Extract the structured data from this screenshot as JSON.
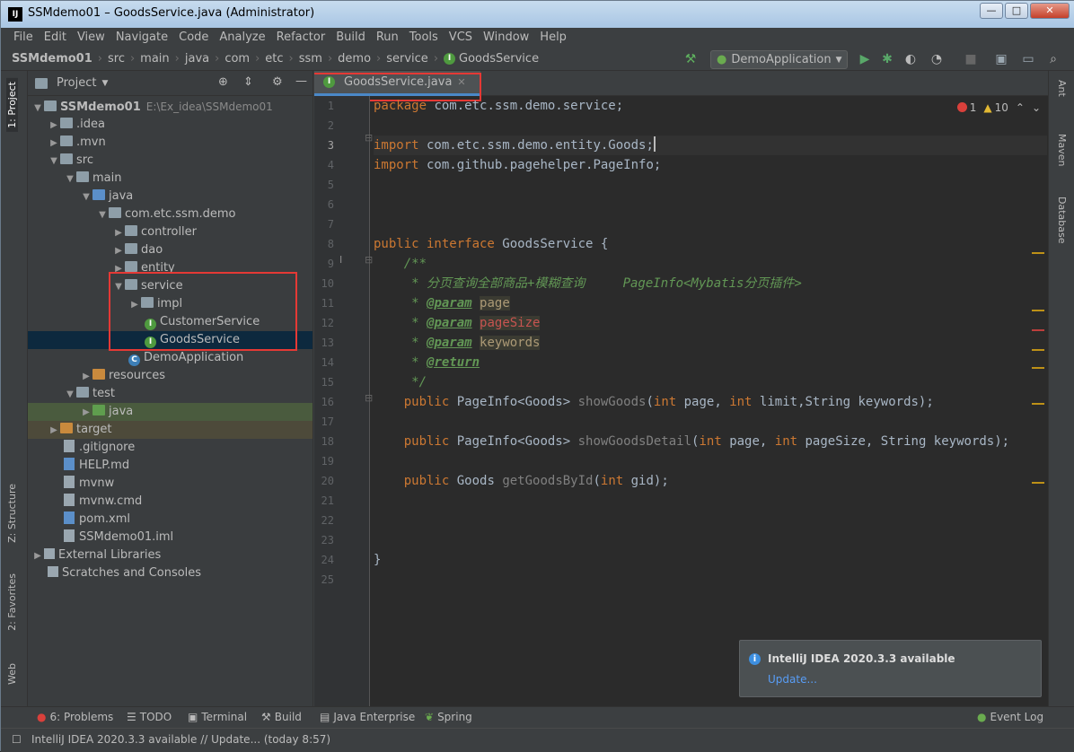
{
  "window": {
    "title": "SSMdemo01 – GoodsService.java (Administrator)",
    "icon": "IJ",
    "controls": {
      "minimize": "—",
      "maximize": "□",
      "close": "✕"
    }
  },
  "menu": [
    "File",
    "Edit",
    "View",
    "Navigate",
    "Code",
    "Analyze",
    "Refactor",
    "Build",
    "Run",
    "Tools",
    "VCS",
    "Window",
    "Help"
  ],
  "breadcrumb": [
    "SSMdemo01",
    "src",
    "main",
    "java",
    "com",
    "etc",
    "ssm",
    "demo",
    "service",
    "GoodsService"
  ],
  "run_config": {
    "label": "DemoApplication"
  },
  "left_tabs": {
    "project": "1: Project",
    "structure": "Z: Structure",
    "favorites": "2: Favorites",
    "web": "Web"
  },
  "right_tabs": {
    "ant": "Ant",
    "maven": "Maven",
    "database": "Database"
  },
  "project_panel": {
    "title": "Project",
    "tree": [
      {
        "label": "SSMdemo01",
        "extra": "E:\\Ex_idea\\SSMdemo01"
      },
      {
        "label": ".idea"
      },
      {
        "label": ".mvn"
      },
      {
        "label": "src"
      },
      {
        "label": "main"
      },
      {
        "label": "java"
      },
      {
        "label": "com.etc.ssm.demo"
      },
      {
        "label": "controller"
      },
      {
        "label": "dao"
      },
      {
        "label": "entity"
      },
      {
        "label": "service"
      },
      {
        "label": "impl"
      },
      {
        "label": "CustomerService"
      },
      {
        "label": "GoodsService"
      },
      {
        "label": "DemoApplication"
      },
      {
        "label": "resources"
      },
      {
        "label": "test"
      },
      {
        "label": "java"
      },
      {
        "label": "target"
      },
      {
        "label": ".gitignore"
      },
      {
        "label": "HELP.md"
      },
      {
        "label": "mvnw"
      },
      {
        "label": "mvnw.cmd"
      },
      {
        "label": "pom.xml"
      },
      {
        "label": "SSMdemo01.iml"
      },
      {
        "label": "External Libraries"
      },
      {
        "label": "Scratches and Consoles"
      }
    ]
  },
  "editor": {
    "tab": "GoodsService.java",
    "inspections": {
      "errors": "1",
      "warnings": "10"
    },
    "line_numbers": [
      "1",
      "2",
      "3",
      "4",
      "5",
      "6",
      "7",
      "8",
      "9",
      "10",
      "11",
      "12",
      "13",
      "14",
      "15",
      "16",
      "17",
      "18",
      "19",
      "20",
      "21",
      "22",
      "23",
      "24",
      "25"
    ],
    "code": {
      "l1_kw": "package",
      "l1_rest": " com.etc.ssm.demo.service;",
      "l3_kw": "import",
      "l3_rest": " com.etc.ssm.demo.entity.Goods;",
      "l4_kw": "import",
      "l4_rest": " com.github.pagehelper.PageInfo;",
      "l8_kw": "public interface",
      "l8_name": " GoodsService",
      "l8_rest": " {",
      "l9": "    /**",
      "l10": "     * 分页查询全部商品+模糊查询     PageInfo<Mybatis分页插件>",
      "l11_pre": "     * ",
      "l11_tag": "@param",
      "l11_p": "page",
      "l12_pre": "     * ",
      "l12_tag": "@param",
      "l12_p": "pageSize",
      "l13_pre": "     * ",
      "l13_tag": "@param",
      "l13_p": "keywords",
      "l14_pre": "     * ",
      "l14_tag": "@return",
      "l15": "     */",
      "l16_kw": "    public",
      "l16_type": " PageInfo<Goods> ",
      "l16_m": "showGoods",
      "l16_a": "(",
      "l16_i1": "int",
      "l16_b": " page, ",
      "l16_i2": "int",
      "l16_c": " limit,String keywords);",
      "l18_kw": "    public",
      "l18_type": " PageInfo<Goods> ",
      "l18_m": "showGoodsDetail",
      "l18_a": "(",
      "l18_i1": "int",
      "l18_b": " page, ",
      "l18_i2": "int",
      "l18_c": " pageSize, String keywords);",
      "l20_kw": "    public",
      "l20_type": " Goods ",
      "l20_m": "getGoodsById",
      "l20_a": "(",
      "l20_i1": "int",
      "l20_c": " gid);",
      "l24": "}"
    }
  },
  "notification": {
    "title": "IntelliJ IDEA 2020.3.3 available",
    "link": "Update..."
  },
  "bottom_tools": {
    "problems": "6: Problems",
    "todo": "TODO",
    "terminal": "Terminal",
    "build": "Build",
    "java_ee": "Java Enterprise",
    "spring": "Spring",
    "event_log": "Event Log"
  },
  "status": "IntelliJ IDEA 2020.3.3 available // Update... (today 8:57)",
  "colors": {
    "accent": "#4a88c7",
    "highlight_box": "#e53935",
    "interface_icon": "#4f9a3f"
  }
}
